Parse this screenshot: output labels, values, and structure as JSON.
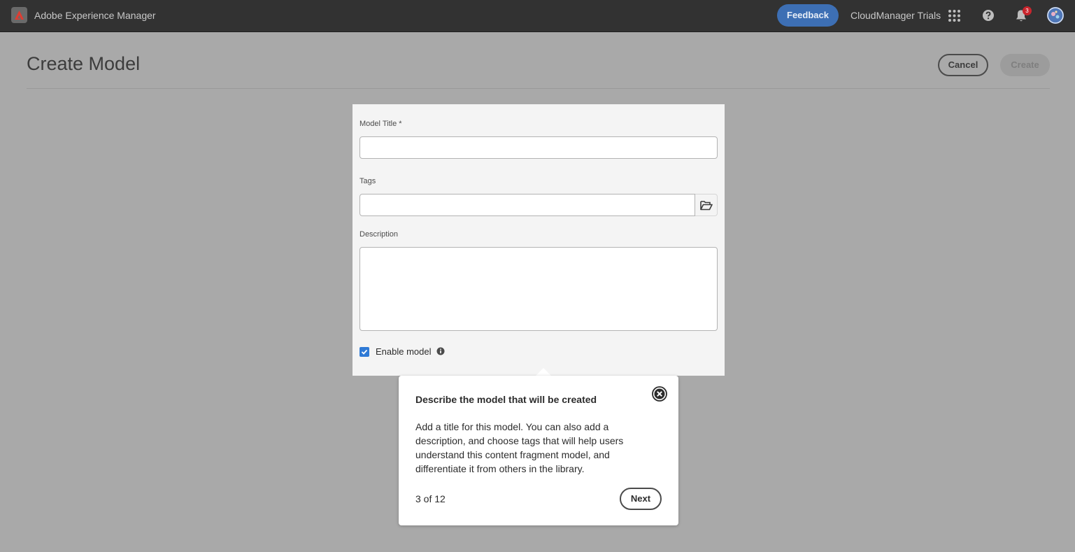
{
  "shell": {
    "app_name": "Adobe Experience Manager",
    "feedback_label": "Feedback",
    "org_name": "CloudManager Trials",
    "notification_count": "3",
    "icons": [
      "adobe-logo-icon",
      "apps-grid-icon",
      "help-icon",
      "bell-icon",
      "avatar"
    ]
  },
  "page": {
    "title": "Create Model",
    "cancel_label": "Cancel",
    "create_label": "Create"
  },
  "form": {
    "model_title_label": "Model Title *",
    "model_title_value": "",
    "tags_label": "Tags",
    "tags_value": "",
    "description_label": "Description",
    "description_value": "",
    "enable_model_label": "Enable model",
    "enable_model_checked": true
  },
  "coachmark": {
    "title": "Describe the model that will be created",
    "body": "Add a title for this model. You can also add a description, and choose tags that will help users understand this content fragment model, and differentiate it from others in the library.",
    "step": "3 of 12",
    "next_label": "Next"
  },
  "colors": {
    "shell_bg": "#323232",
    "overlay_bg": "#a9a9a9",
    "accent": "#3d6fb4",
    "checkbox": "#2f7ad6",
    "badge": "#c9252d"
  }
}
